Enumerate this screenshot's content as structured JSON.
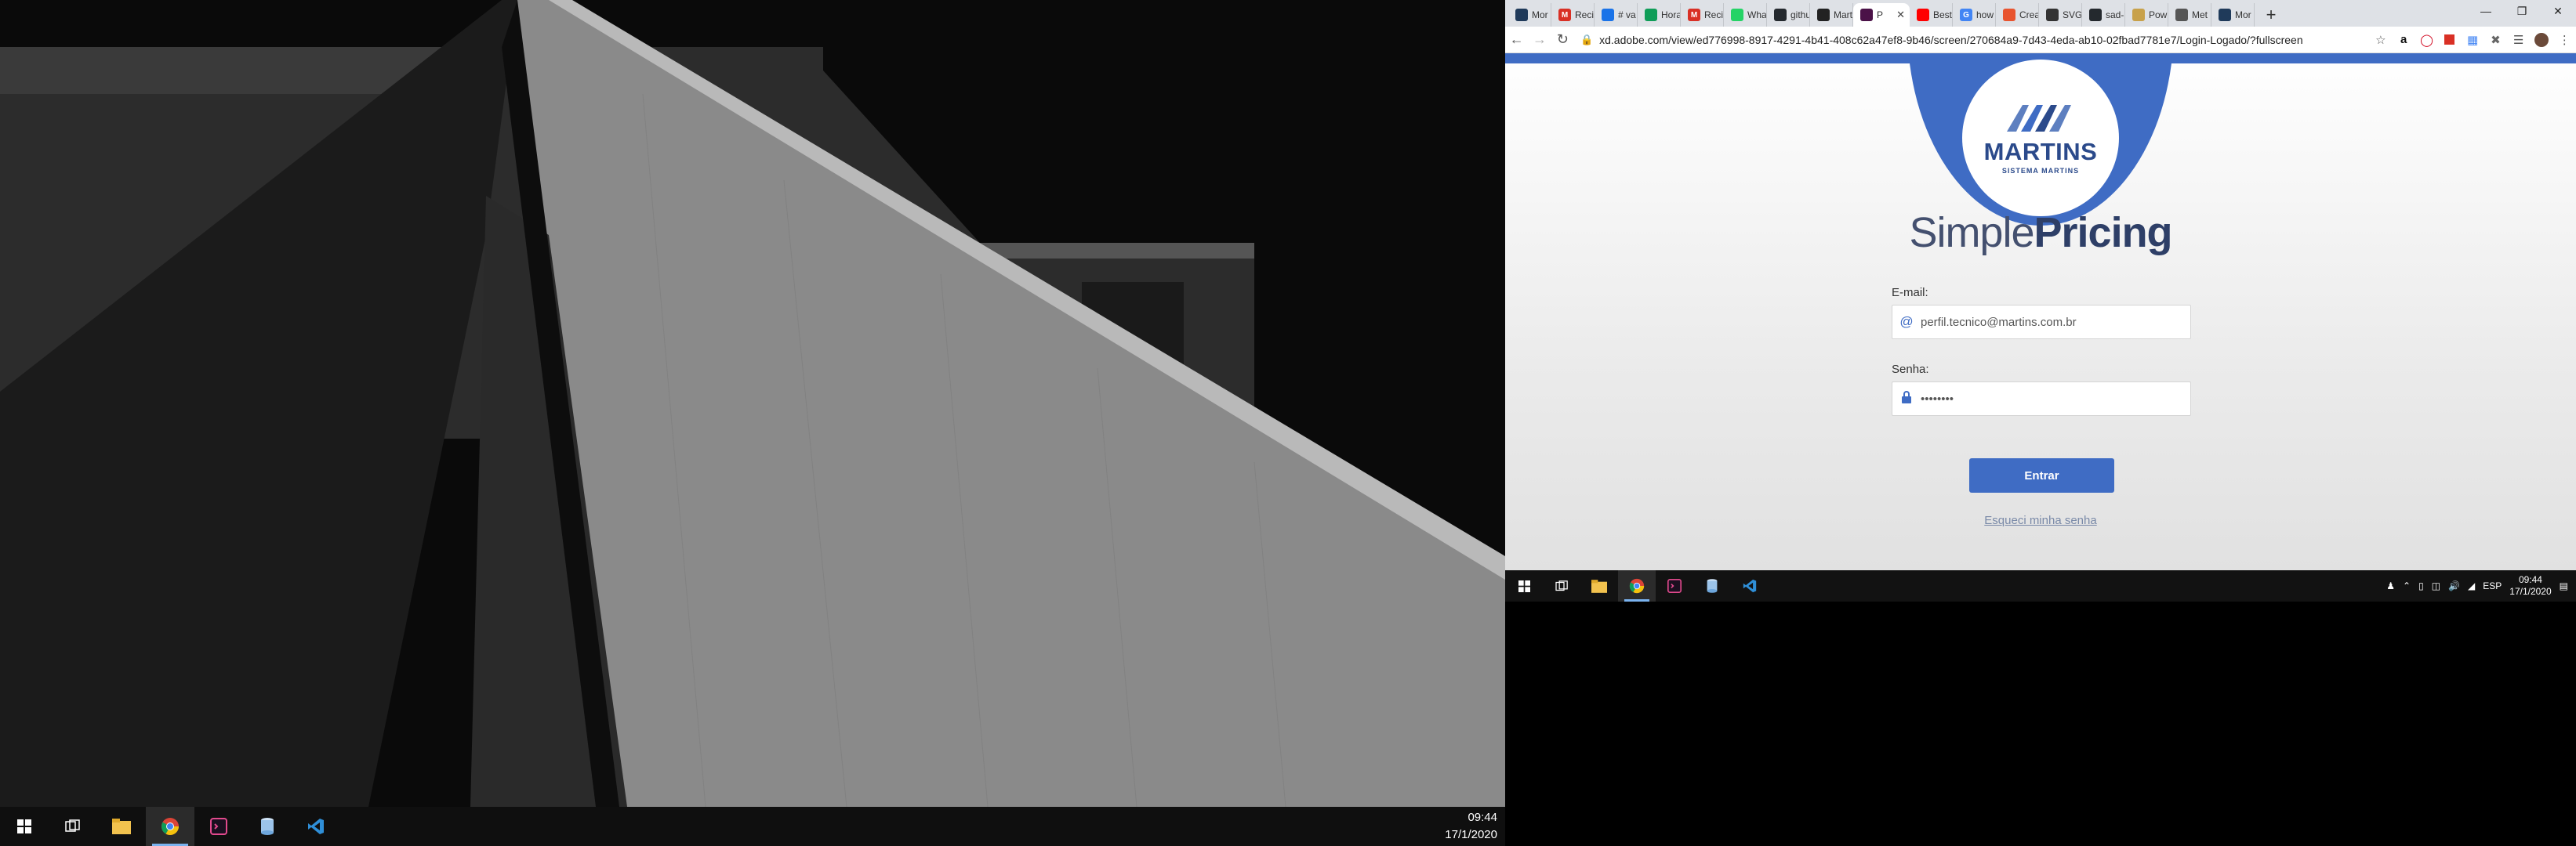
{
  "left_monitor": {
    "taskbar": {
      "items": [
        {
          "icon": "windows-start-icon"
        },
        {
          "icon": "task-view-icon"
        },
        {
          "icon": "file-explorer-icon"
        },
        {
          "icon": "chrome-icon",
          "active": true
        },
        {
          "icon": "terminal-app-icon"
        },
        {
          "icon": "database-app-icon"
        },
        {
          "icon": "vscode-icon"
        }
      ],
      "time": "09:44",
      "date": "17/1/2020"
    }
  },
  "browser": {
    "tabs": [
      {
        "label": "Mor",
        "color": "#1f3a5a"
      },
      {
        "label": "Recil",
        "color": "#d93025",
        "glyph": "M"
      },
      {
        "label": "# va",
        "color": "#1a73e8"
      },
      {
        "label": "Hora",
        "color": "#0f9d58"
      },
      {
        "label": "Recil",
        "color": "#d93025",
        "glyph": "M"
      },
      {
        "label": "Wha",
        "color": "#25d366"
      },
      {
        "label": "githu",
        "color": "#24292e"
      },
      {
        "label": "Mart",
        "color": "#222"
      },
      {
        "label": "P",
        "color": "#4b1248",
        "active": true
      },
      {
        "label": "Best",
        "color": "#ff0000"
      },
      {
        "label": "how",
        "color": "#4285f4",
        "glyph": "G"
      },
      {
        "label": "Crea",
        "color": "#e8542f"
      },
      {
        "label": "SVG",
        "color": "#333"
      },
      {
        "label": "sad-",
        "color": "#24292e"
      },
      {
        "label": "Pow",
        "color": "#c8a14a"
      },
      {
        "label": "Met",
        "color": "#555"
      },
      {
        "label": "Mor",
        "color": "#1f3a5a"
      }
    ],
    "url": "xd.adobe.com/view/ed776998-8917-4291-4b41-408c62a47ef8-9b46/screen/270684a9-7d43-4eda-ab10-02fbad7781e7/Login-Logado/?fullscreen"
  },
  "page": {
    "logo": {
      "name": "MARTINS",
      "subtitle": "SISTEMA MARTINS"
    },
    "title_light": "Simple",
    "title_bold": "Pricing",
    "email_label": "E-mail:",
    "email_value": "perfil.tecnico@martins.com.br",
    "password_label": "Senha:",
    "password_value": "••••••••",
    "login_button": "Entrar",
    "forgot_link": "Esqueci minha senha",
    "colors": {
      "accent": "#3f6cc4",
      "brand": "#2b4a8b"
    }
  },
  "right_taskbar": {
    "language": "ESP",
    "time": "09:44",
    "date": "17/1/2020"
  }
}
